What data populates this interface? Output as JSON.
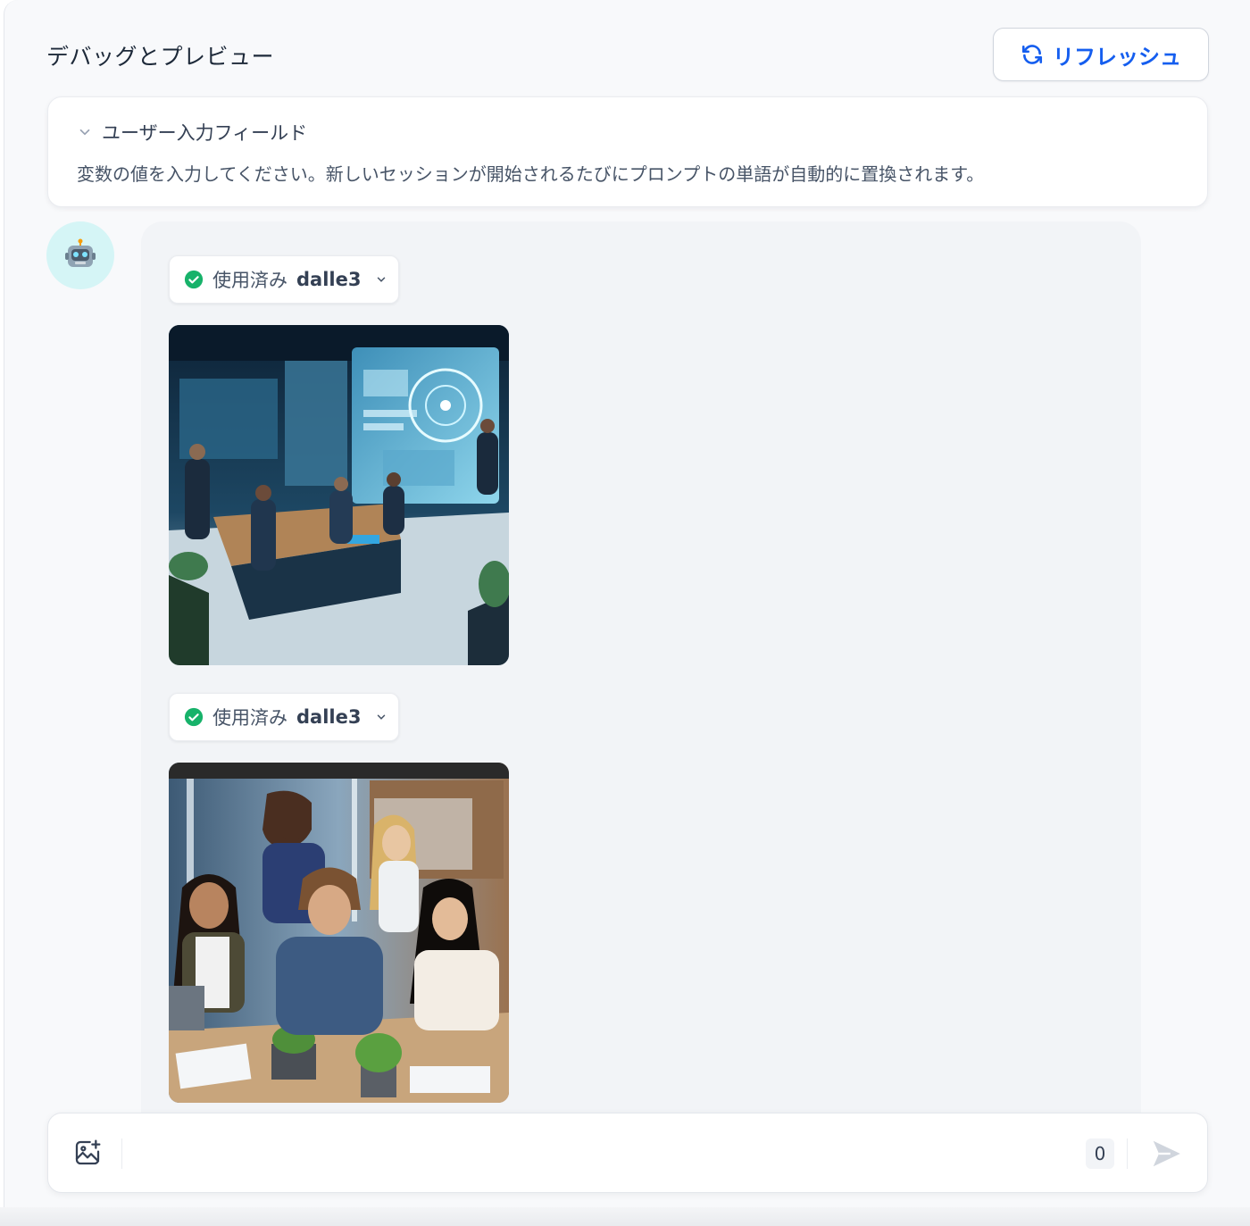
{
  "header": {
    "title": "デバッグとプレビュー",
    "refresh_label": "リフレッシュ"
  },
  "user_input_card": {
    "toggle_label": "ユーザー入力フィールド",
    "description": "変数の値を入力してください。新しいセッションが開始されるたびにプロンプトの単語が自動的に置換されます。"
  },
  "chat": {
    "avatar_icon": "robot-icon",
    "messages": [
      {
        "tool_status": "使用済み",
        "tool_name": "dalle3"
      },
      {
        "tool_status": "使用済み",
        "tool_name": "dalle3"
      }
    ]
  },
  "composer": {
    "placeholder": "",
    "char_count": "0"
  },
  "colors": {
    "accent": "#155eef",
    "success": "#17b26a",
    "avatar_bg": "#d5f5f6"
  }
}
